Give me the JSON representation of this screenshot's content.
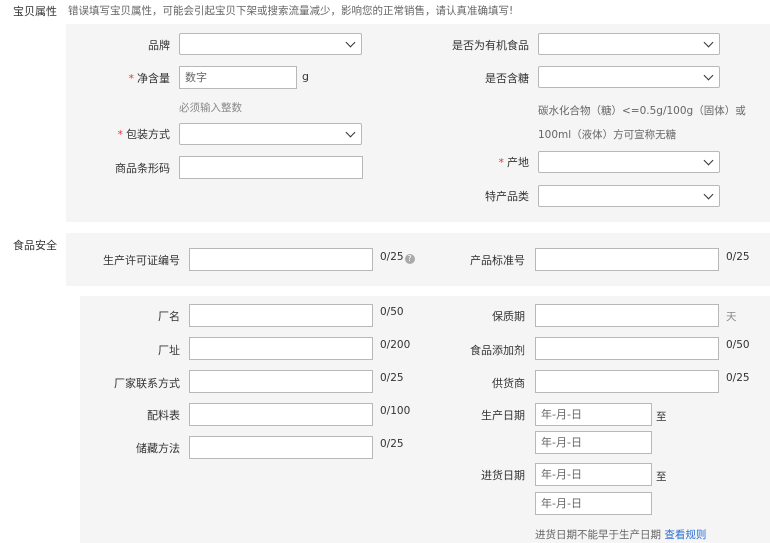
{
  "attributes": {
    "section_label": "宝贝属性",
    "warning": "错误填写宝贝属性，可能会引起宝贝下架或搜索流量减少，影响您的正常销售，请认真准确填写!",
    "brand_label": "品牌",
    "organic_label": "是否为有机食品",
    "net_weight_label": "净含量",
    "net_weight_placeholder": "数字",
    "net_weight_unit": "g",
    "net_weight_hint": "必须输入整数",
    "sugar_label": "是否含糖",
    "sugar_hint_line1": "碳水化合物（糖）<=0.5g/100g（固体）或",
    "sugar_hint_line2": "100ml（液体）方可宣称无糖",
    "packaging_label": "包装方式",
    "barcode_label": "商品条形码",
    "origin_label": "产地",
    "specialty_label": "特产品类",
    "required_mark": "*"
  },
  "food_safety": {
    "section_label": "食品安全",
    "license_label": "生产许可证编号",
    "license_count": "0/25",
    "standard_label": "产品标准号",
    "standard_count": "0/25",
    "factory_name_label": "厂名",
    "factory_name_count": "0/50",
    "factory_addr_label": "厂址",
    "factory_addr_count": "0/200",
    "factory_contact_label": "厂家联系方式",
    "factory_contact_count": "0/25",
    "ingredients_label": "配料表",
    "ingredients_count": "0/100",
    "storage_label": "储藏方法",
    "storage_count": "0/25",
    "shelf_life_label": "保质期",
    "shelf_life_unit": "天",
    "additive_label": "食品添加剂",
    "additive_count": "0/50",
    "supplier_label": "供货商",
    "supplier_count": "0/25",
    "production_date_label": "生产日期",
    "date_placeholder": "年-月-日",
    "to_label": "至",
    "purchase_date_label": "进货日期",
    "purchase_hint": "进货日期不能早于生产日期",
    "rules_link": "查看规则"
  }
}
